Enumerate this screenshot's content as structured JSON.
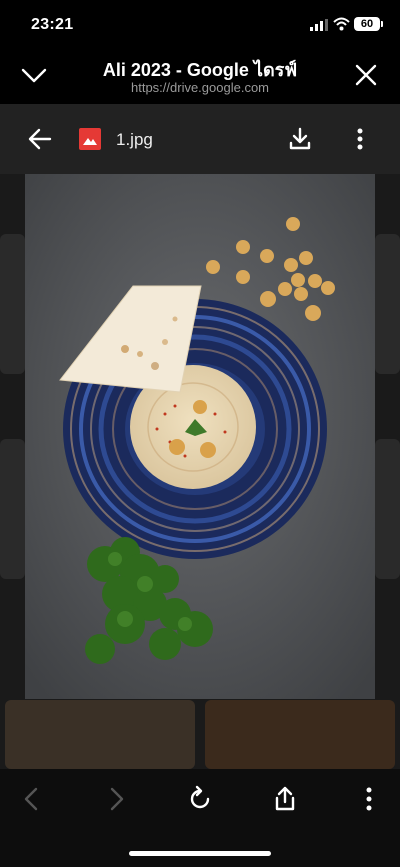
{
  "status": {
    "time": "23:21",
    "battery": "60"
  },
  "browser": {
    "title": "Ali 2023 - Google ไดรฟ์",
    "url": "https://drive.google.com"
  },
  "viewer": {
    "file_name": "1.jpg",
    "file_type_icon": "image-file-icon"
  },
  "photo": {
    "description_icons": [
      "hummus-plate",
      "pita-bread",
      "chickpeas",
      "parsley"
    ]
  },
  "colors": {
    "background": "#000000",
    "viewer_bg": "#1a1a1a",
    "file_icon_red": "#e53935",
    "url_gray": "#9a9a9a"
  }
}
